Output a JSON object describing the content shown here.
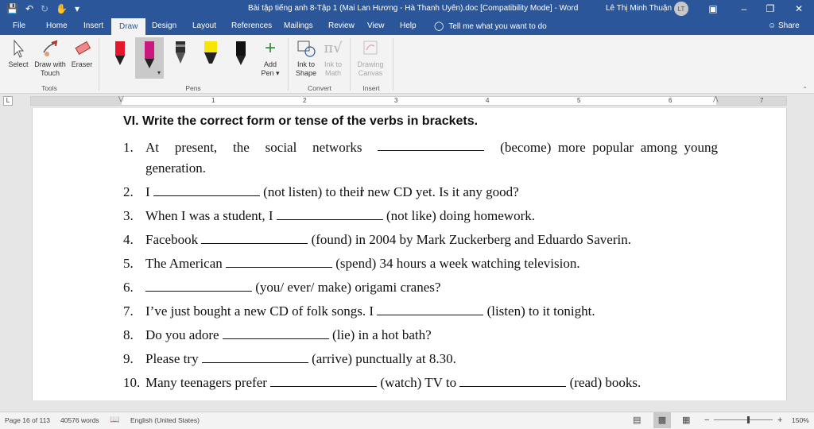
{
  "titlebar": {
    "title": "Bài tập tiếng anh 8-Tập 1 (Mai Lan Hương - Hà Thanh Uyên).doc [Compatibility Mode]  -  Word",
    "user": "Lê Thị Minh Thuận",
    "avatar_initials": "LT"
  },
  "tabs": [
    "File",
    "Home",
    "Insert",
    "Draw",
    "Design",
    "Layout",
    "References",
    "Mailings",
    "Review",
    "View",
    "Help"
  ],
  "active_tab": "Draw",
  "tell_me": "Tell me what you want to do",
  "share": "Share",
  "ribbon": {
    "tools": {
      "select": "Select",
      "draw_with_touch_1": "Draw with",
      "draw_with_touch_2": "Touch",
      "eraser": "Eraser",
      "label": "Tools"
    },
    "pens": {
      "label": "Pens",
      "add_pen_1": "Add",
      "add_pen_2": "Pen ▾",
      "colors": [
        "#e4162b",
        "#c9197e",
        "#2e2e2e",
        "#f5e500",
        "#111111"
      ]
    },
    "convert": {
      "ink_to_shape_1": "Ink to",
      "ink_to_shape_2": "Shape",
      "ink_to_math_1": "Ink to",
      "ink_to_math_2": "Math",
      "label": "Convert"
    },
    "insert": {
      "drawing_canvas_1": "Drawing",
      "drawing_canvas_2": "Canvas",
      "label": "Insert"
    }
  },
  "ruler": {
    "corner": "L",
    "numbers": [
      "1",
      "2",
      "3",
      "4",
      "5",
      "6",
      "7"
    ]
  },
  "document": {
    "heading": "VI.  Write the correct form or tense of the verbs in brackets.",
    "q1": {
      "num": "1.",
      "words": [
        "At",
        "present,",
        "the",
        "social",
        "networks"
      ],
      "after": "(become)  more  popular  among  young",
      "line2": "generation."
    },
    "q2": {
      "num": "2.",
      "before": "I ",
      "after": " (not listen) to their new CD yet. Is it any good?"
    },
    "q3": {
      "num": "3.",
      "before": "When I was a student, I ",
      "after": " (not like) doing homework."
    },
    "q4": {
      "num": "4.",
      "before": "Facebook ",
      "after": " (found) in 2004 by Mark Zuckerberg and Eduardo Saverin."
    },
    "q5": {
      "num": "5.",
      "before": "The American ",
      "after": " (spend) 34 hours a week watching television."
    },
    "q6": {
      "num": "6.",
      "before": "",
      "after": " (you/ ever/ make) origami cranes?"
    },
    "q7": {
      "num": "7.",
      "before": "I’ve just bought a new CD of folk songs. I ",
      "after": " (listen) to it tonight."
    },
    "q8": {
      "num": "8.",
      "before": "Do you adore ",
      "after": " (lie) in a hot bath?"
    },
    "q9": {
      "num": "9.",
      "before": "Please try ",
      "after": " (arrive) punctually at 8.30."
    },
    "q10": {
      "num": "10.",
      "before": "Many teenagers prefer ",
      "middle": " (watch) TV to ",
      "after": " (read) books."
    }
  },
  "status": {
    "page": "Page 16 of 113",
    "words": "40576 words",
    "language": "English (United States)",
    "zoom": "150%",
    "zoom_minus": "−",
    "zoom_plus": "+"
  }
}
